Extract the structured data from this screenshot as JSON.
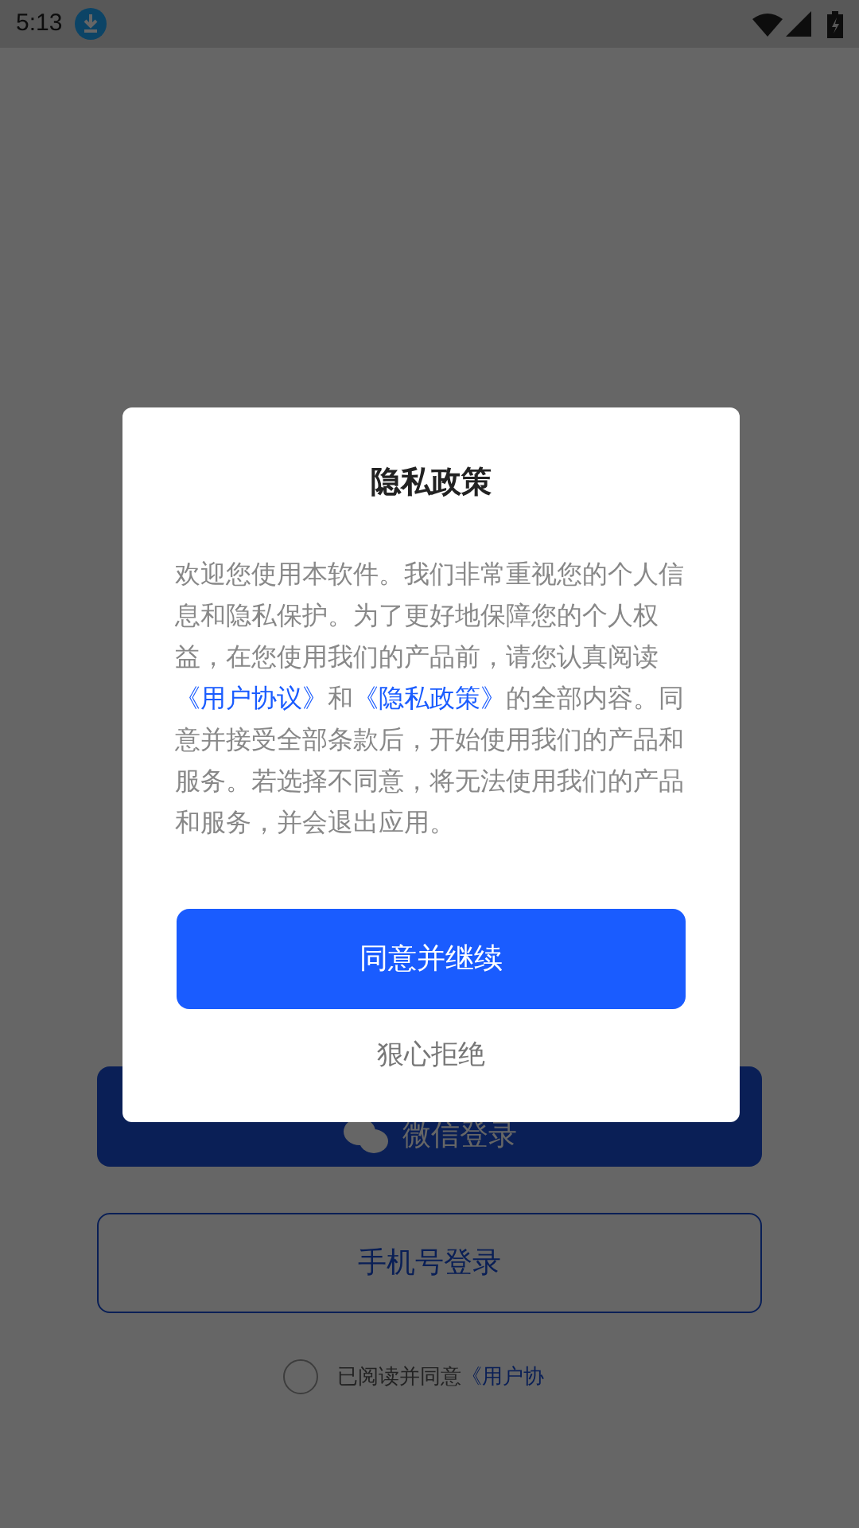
{
  "status_bar": {
    "time": "5:13"
  },
  "login": {
    "buttons": [
      {
        "kind": "wechat",
        "label": "微信登录"
      },
      {
        "kind": "phone",
        "label": "手机号登录"
      }
    ],
    "agreement": {
      "checked": false,
      "text": "已阅读并同意",
      "link": "《用户协"
    }
  },
  "dialog": {
    "title": "隐私政策",
    "body": [
      {
        "kind": "plain",
        "text": "欢迎您使用本软件。我们非常重视您的个人信息和隐私保护。为了更好地保障您的个人权益，在您使用我们的产品前，请您认真阅读"
      },
      {
        "kind": "link",
        "text": "《用户协议》"
      },
      {
        "kind": "plain",
        "text": "和"
      },
      {
        "kind": "link",
        "text": "《隐私政策》"
      },
      {
        "kind": "plain",
        "text": "的全部内容。同意并接受全部条款后，开始使用我们的产品和服务。若选择不同意，将无法使用我们的产品和服务，并会退出应用。"
      }
    ],
    "confirm": "同意并继续",
    "decline": "狠心拒绝"
  }
}
